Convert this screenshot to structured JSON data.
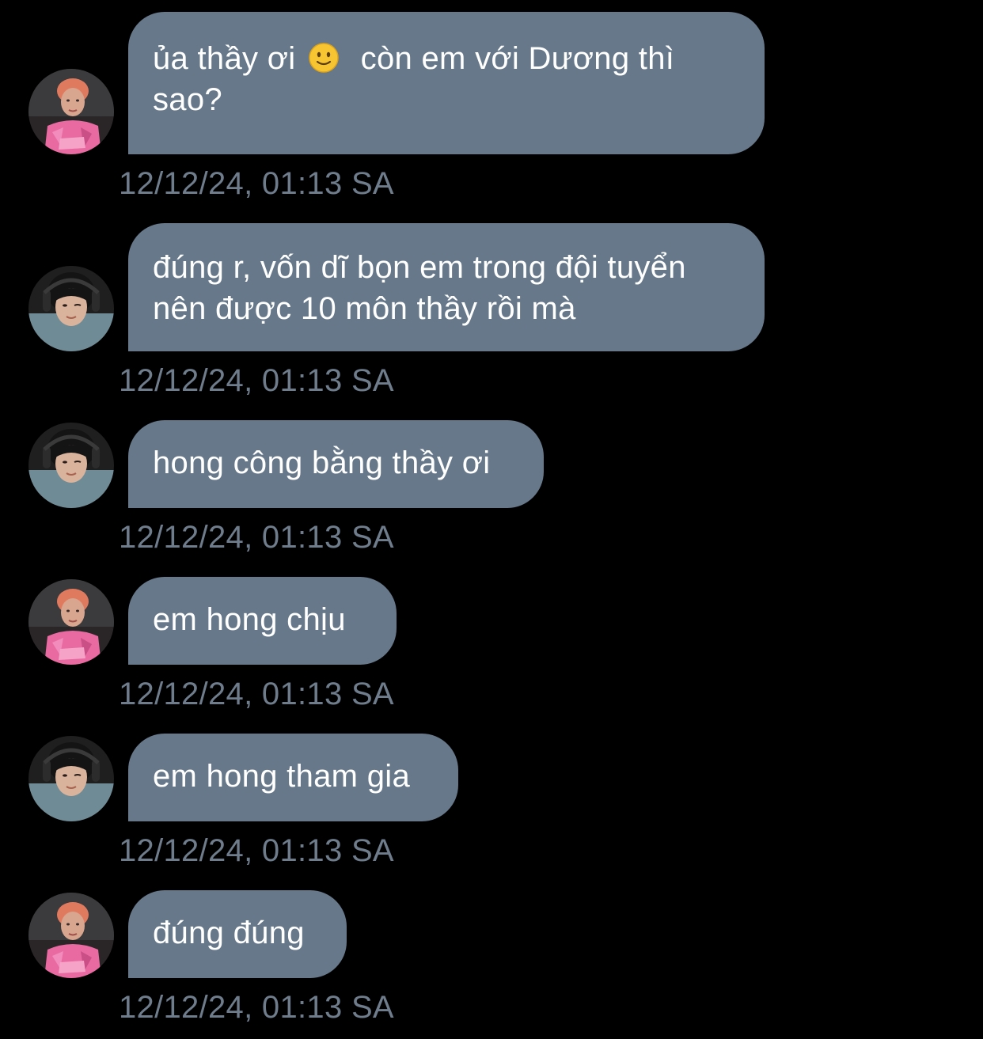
{
  "messages": [
    {
      "sender": "user-pink",
      "text_before": "ủa thầy ơi ",
      "emoji": "slightly-smiling-face",
      "text_after": "  còn em với Dương thì sao?",
      "timestamp": "12/12/24, 01:13 SA"
    },
    {
      "sender": "user-dark",
      "text": "đúng r, vốn dĩ bọn em trong đội tuyển nên được 10 môn thầy rồi mà",
      "timestamp": "12/12/24, 01:13 SA"
    },
    {
      "sender": "user-dark",
      "text": "hong công bằng thầy ơi",
      "timestamp": "12/12/24, 01:13 SA"
    },
    {
      "sender": "user-pink",
      "text": "em hong chịu",
      "timestamp": "12/12/24, 01:13 SA"
    },
    {
      "sender": "user-dark",
      "text": "em hong tham gia",
      "timestamp": "12/12/24, 01:13 SA"
    },
    {
      "sender": "user-pink",
      "text": "đúng đúng",
      "timestamp": "12/12/24, 01:13 SA"
    }
  ],
  "colors": {
    "background": "#000000",
    "bubble": "#66788a",
    "timestamp": "#6e7c8b",
    "text": "#ffffff"
  }
}
